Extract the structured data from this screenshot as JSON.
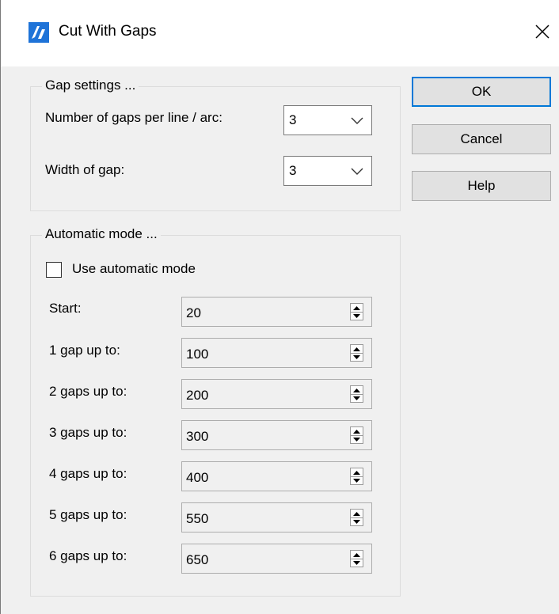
{
  "window": {
    "title": "Cut With Gaps"
  },
  "icons": {
    "app": "bricscad-logo-icon",
    "close": "close-icon",
    "dropdown": "chevron-down-icon",
    "spin_up": "spin-up-icon",
    "spin_down": "spin-down-icon"
  },
  "colors": {
    "app_icon": "#1e73d8",
    "default_button_border": "#0078d7",
    "dialog_bg": "#f0f0f0"
  },
  "gap_settings": {
    "legend": "Gap settings ...",
    "gaps_per_line_label": "Number of gaps per line / arc:",
    "gaps_per_line_value": "3",
    "width_label": "Width of gap:",
    "width_value": "3"
  },
  "buttons": {
    "ok": "OK",
    "cancel": "Cancel",
    "help": "Help"
  },
  "automatic_mode": {
    "legend": "Automatic mode ...",
    "checkbox_label": "Use automatic mode",
    "checked": false,
    "rows": [
      {
        "label": "Start:",
        "value": "20"
      },
      {
        "label": "1 gap up to:",
        "value": "100"
      },
      {
        "label": "2 gaps up to:",
        "value": "200"
      },
      {
        "label": "3 gaps up to:",
        "value": "300"
      },
      {
        "label": "4 gaps up to:",
        "value": "400"
      },
      {
        "label": "5 gaps up to:",
        "value": "550"
      },
      {
        "label": "6 gaps up to:",
        "value": "650"
      }
    ]
  }
}
